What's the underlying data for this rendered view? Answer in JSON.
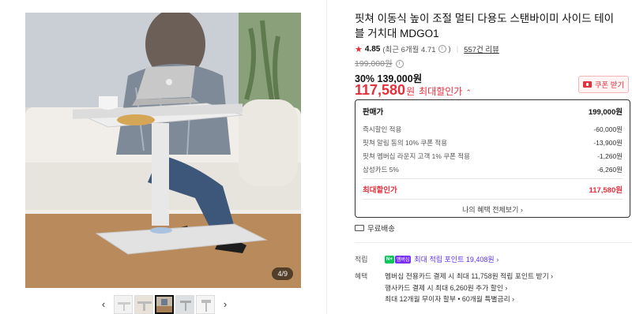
{
  "gallery": {
    "counter": "4/9",
    "thumbnail_count": 5,
    "active_thumbnail": 3
  },
  "product": {
    "title": "핏쳐 이동식 높이 조절 멀티 다용도 스탠바이미 사이드 테이블 거치대 MDGO1",
    "rating": "4.85",
    "rating_recent": "(최근 6개월 4.71",
    "rating_recent_close": ")",
    "review_count": "557건 리뷰",
    "original_price": "199,000원",
    "discount_rate": "30%",
    "sale_price": "139,000원",
    "final_price": "117,580",
    "final_unit": "원",
    "final_label": "최대할인가",
    "coupon_label": "쿠폰 받기"
  },
  "benefit_box": {
    "header_label": "판매가",
    "header_amount": "199,000원",
    "rows": [
      {
        "label": "즉시할인 적용",
        "amount": "-60,000원"
      },
      {
        "label": "핏쳐 알림 동의 10% 쿠폰 적용",
        "amount": "-13,900원"
      },
      {
        "label": "핏쳐 멤버십 라운지 고객 1% 쿠폰 적용",
        "amount": "-1,260원"
      },
      {
        "label": "삼성카드 5%",
        "amount": "-6,260원"
      }
    ],
    "max_label": "최대할인가",
    "max_amount": "117,580원",
    "more_link": "나의 혜택 전체보기"
  },
  "shipping": {
    "label": "무료배송"
  },
  "points": {
    "label": "적립",
    "badge_n": "N+",
    "badge_text": "멤버십",
    "link": "최대 적립 포인트 19,408원"
  },
  "benefits": {
    "label": "혜택",
    "items": [
      "멤버십 전용카드 결제 시 최대 11,758원 적립 포인트 받기",
      "행사카드 결제 시 최대 6,260원 추가 할인",
      "최대 12개월 무이자 할부 • 60개월 특별금리"
    ]
  },
  "colors": {
    "accent_red": "#e4303c",
    "point_purple": "#5a2ff0",
    "naver_green": "#03c75a"
  }
}
